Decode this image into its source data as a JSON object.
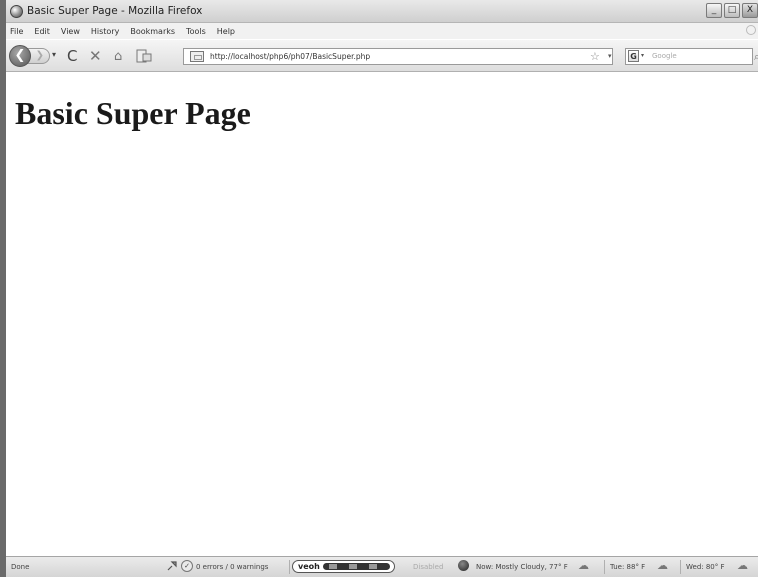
{
  "window": {
    "title": "Basic Super Page - Mozilla Firefox",
    "controls": {
      "minimize": "_",
      "maximize": "□",
      "close": "X"
    }
  },
  "menubar": {
    "items": [
      "File",
      "Edit",
      "View",
      "History",
      "Bookmarks",
      "Tools",
      "Help"
    ]
  },
  "navbar": {
    "back": "❮",
    "forward": "❯",
    "reload": "C",
    "stop": "✕",
    "home": "⌂",
    "url": "http://localhost/php6/ph07/BasicSuper.php",
    "star": "☆",
    "dropdown": "▾",
    "search_engine": "G",
    "search_placeholder": "Google",
    "search_go": "⌕"
  },
  "page": {
    "heading": "Basic Super Page"
  },
  "statusbar": {
    "status": "Done",
    "errors": "0 errors / 0 warnings",
    "veoh": "veoh",
    "disabled": "Disabled",
    "now": "Now: Mostly Cloudy, 77° F",
    "tue": "Tue: 88° F",
    "wed": "Wed: 80° F"
  }
}
